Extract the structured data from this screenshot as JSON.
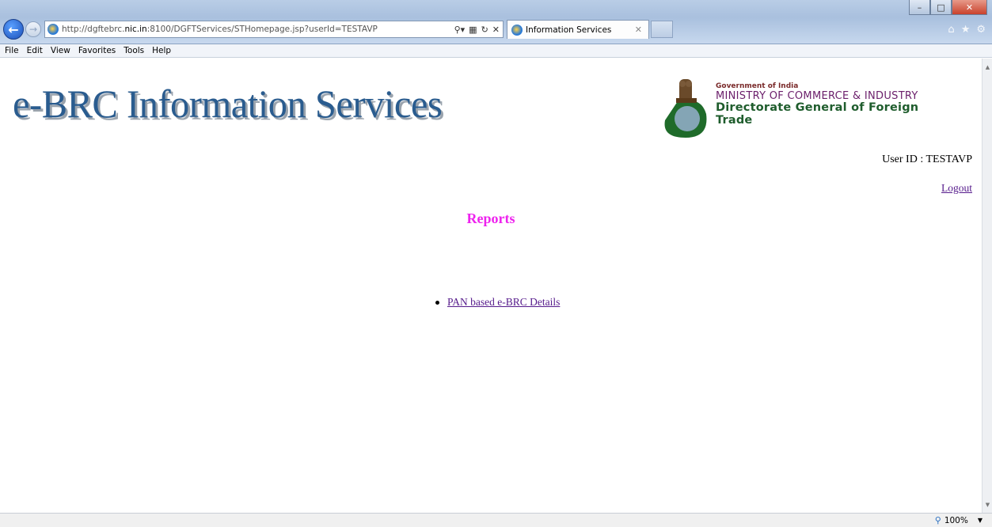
{
  "browser": {
    "url_prefix": "http://dgftebrc.",
    "url_host": "nic.in",
    "url_suffix": ":8100/DGFTServices/STHomepage.jsp?userId=TESTAVP",
    "tab_title": "Information Services",
    "menu": [
      "File",
      "Edit",
      "View",
      "Favorites",
      "Tools",
      "Help"
    ],
    "zoom": "100%"
  },
  "page": {
    "site_title": "e-BRC Information Services",
    "logo": {
      "line1": "Government of India",
      "line2": "MINISTRY OF COMMERCE & INDUSTRY",
      "line3": "Directorate General of Foreign Trade"
    },
    "user_id": "User ID : TESTAVP",
    "logout": "Logout",
    "reports_heading": "Reports",
    "report_links": [
      "PAN based e-BRC Details"
    ]
  }
}
